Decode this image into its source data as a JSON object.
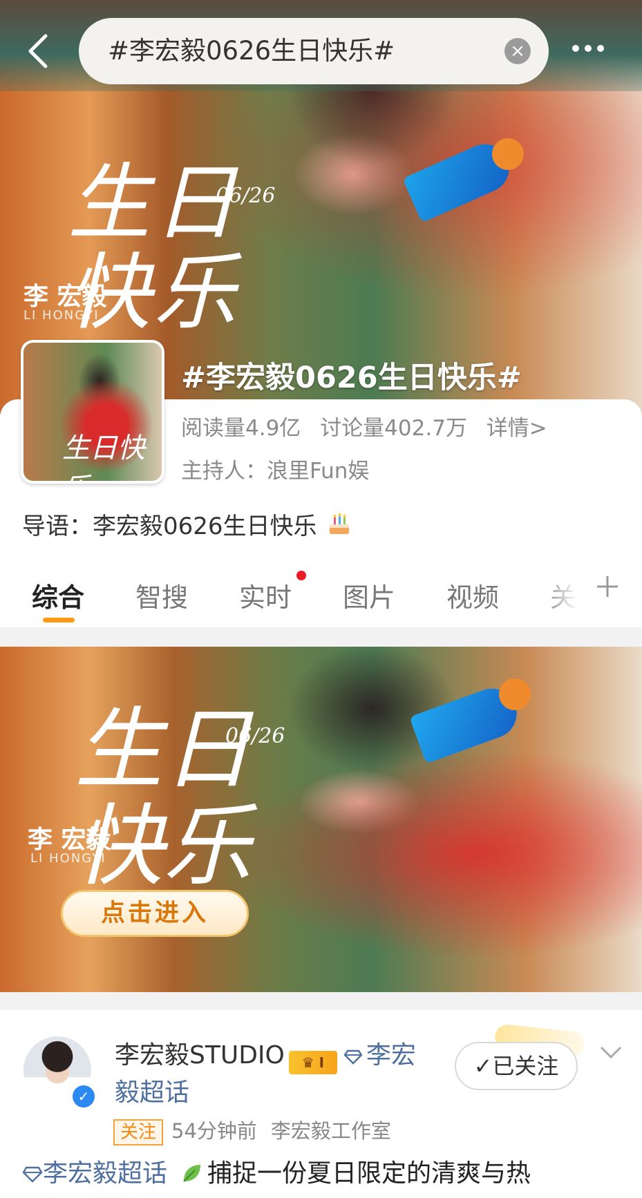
{
  "search": {
    "query": "#李宏毅0626生日快乐#"
  },
  "banner": {
    "birthday_text": "生日快乐",
    "date": "06/26",
    "name_cn": "李  宏毅",
    "name_en": "LI  HONGYI"
  },
  "topic": {
    "title": "#李宏毅0626生日快乐#",
    "reads": "阅读量4.9亿",
    "discussions": "讨论量402.7万",
    "details_link": "详情>",
    "host": "主持人：浪里Fun娱",
    "intro": "导语：李宏毅0626生日快乐",
    "thumb_text": "生日快乐"
  },
  "tabs": [
    "综合",
    "智搜",
    "实时",
    "图片",
    "视频",
    "关"
  ],
  "promo": {
    "birthday_text": "生日快乐",
    "date": "06/26",
    "name_cn": "李  宏毅",
    "name_en": "LI  HONGYI",
    "enter_label": "点击进入"
  },
  "post": {
    "author": "李宏毅STUDIO",
    "badge": "I",
    "supertopic_tag": "李宏毅超话",
    "follow_button": "已关注",
    "follow_tag": "关注",
    "time": "54分钟前",
    "source": "李宏毅工作室",
    "text_topic": "李宏毅超话",
    "text": "捕捉一份夏日限定的清爽与热"
  },
  "colors": {
    "accent_orange": "#ff9a14",
    "link_blue": "#4e6f9f",
    "red_dot": "#ec1b26"
  }
}
